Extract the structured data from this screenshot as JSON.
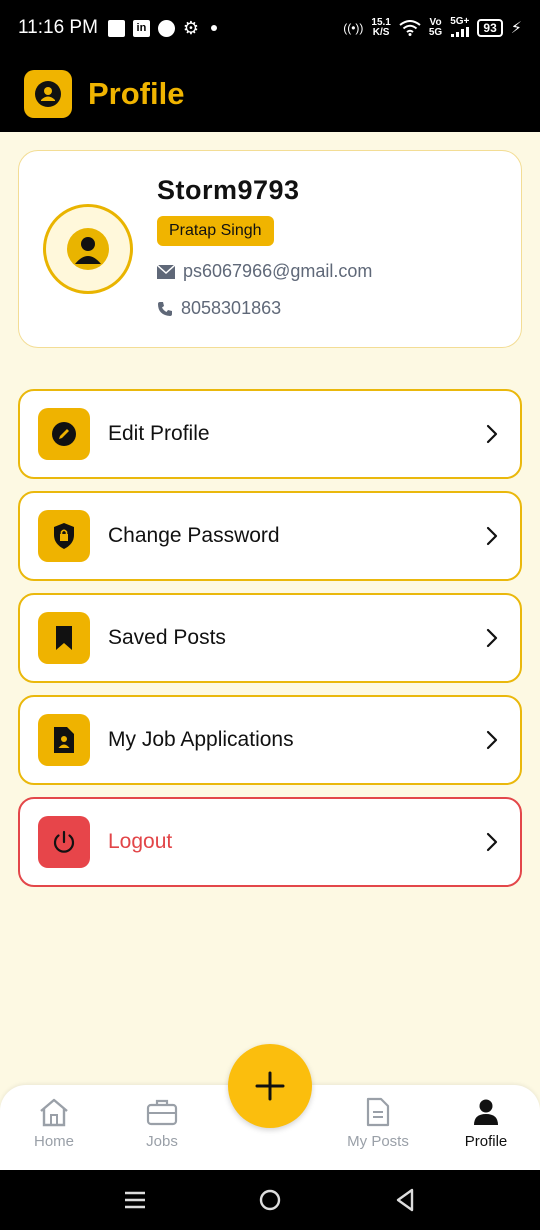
{
  "status_bar": {
    "time": "11:16 PM",
    "net_speed_value": "15.1",
    "net_speed_unit": "K/S",
    "network_label_top": "Vo",
    "network_label_bottom": "5G",
    "signal_label": "5G+",
    "battery": "93"
  },
  "header": {
    "title": "Profile",
    "icon": "account-circle-icon"
  },
  "profile": {
    "username": "Storm9793",
    "full_name": "Pratap Singh",
    "email": "ps6067966@gmail.com",
    "phone": "8058301863"
  },
  "menu": {
    "items": [
      {
        "label": "Edit Profile",
        "icon": "edit-icon"
      },
      {
        "label": "Change Password",
        "icon": "shield-lock-icon"
      },
      {
        "label": "Saved Posts",
        "icon": "bookmark-icon"
      },
      {
        "label": "My Job Applications",
        "icon": "application-document-icon"
      },
      {
        "label": "Logout",
        "icon": "power-icon"
      }
    ]
  },
  "bottom_nav": {
    "items": [
      {
        "label": "Home",
        "icon": "home-icon",
        "active": false
      },
      {
        "label": "Jobs",
        "icon": "briefcase-icon",
        "active": false
      },
      {
        "label": "My Posts",
        "icon": "document-icon",
        "active": false
      },
      {
        "label": "Profile",
        "icon": "person-icon",
        "active": true
      }
    ],
    "fab_icon": "plus-icon"
  },
  "colors": {
    "accent": "#f0b400",
    "background": "#fdf9e3",
    "danger": "#e3474a",
    "header_bg": "#000000"
  }
}
